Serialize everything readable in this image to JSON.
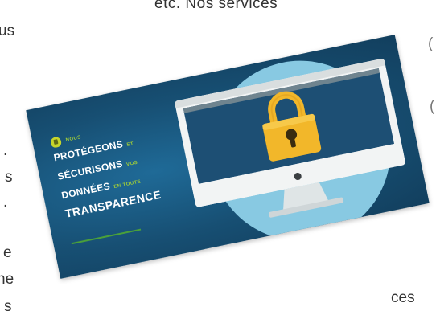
{
  "article": {
    "top_fragment": "etc.   Nos   services",
    "left_fragments": [
      "us",
      ".",
      "s",
      ".",
      "e",
      "ne",
      "s"
    ],
    "bottom_right_fragment": "ces",
    "right_edge_fragments": [
      "(",
      "("
    ]
  },
  "banner": {
    "line1_small": "NOUS",
    "line2_big": "PROTÉGEONS",
    "line2_small": "ET",
    "line3_big": "SÉCURISONS",
    "line3_small": "VOS",
    "line4_big": "DONNÉES",
    "line4_small": "EN TOUTE",
    "line5_big": "TRANSPARENCE"
  },
  "colors": {
    "card_blue": "#174f73",
    "halo": "#88c9e2",
    "lock_gold": "#f2b72a",
    "accent_green": "#9ecb3a",
    "shield_yellow": "#c6d52b"
  },
  "icons": {
    "badge": "shield-icon",
    "lock": "padlock-icon",
    "computer": "monitor-icon"
  }
}
